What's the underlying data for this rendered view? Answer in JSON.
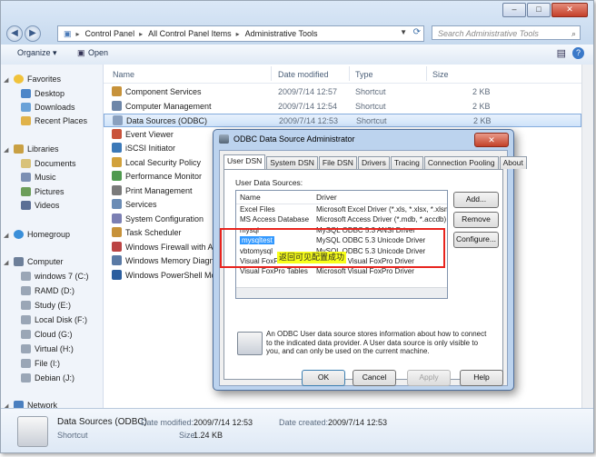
{
  "window": {
    "controls": {
      "minimize": "–",
      "maximize": "□",
      "close": "✕"
    },
    "address": {
      "crumbs": [
        "Control Panel",
        "All Control Panel Items",
        "Administrative Tools"
      ]
    },
    "search_placeholder": "Search Administrative Tools"
  },
  "toolbar": {
    "organize": "Organize ▾",
    "open": "Open",
    "help": "?"
  },
  "nav": {
    "favorites": "Favorites",
    "fav_items": [
      "Desktop",
      "Downloads",
      "Recent Places"
    ],
    "libraries": "Libraries",
    "lib_items": [
      "Documents",
      "Music",
      "Pictures",
      "Videos"
    ],
    "homegroup": "Homegroup",
    "computer": "Computer",
    "drives": [
      "windows 7 (C:)",
      "RAMD (D:)",
      "Study (E:)",
      "Local Disk (F:)",
      "Cloud (G:)",
      "Virtual (H:)",
      "File (I:)",
      "Debian (J:)"
    ],
    "network": "Network"
  },
  "columns": {
    "name": "Name",
    "date": "Date modified",
    "type": "Type",
    "size": "Size"
  },
  "files": [
    {
      "name": "Component Services",
      "date": "2009/7/14 12:57",
      "type": "Shortcut",
      "size": "2 KB"
    },
    {
      "name": "Computer Management",
      "date": "2009/7/14 12:54",
      "type": "Shortcut",
      "size": "2 KB"
    },
    {
      "name": "Data Sources (ODBC)",
      "date": "2009/7/14 12:53",
      "type": "Shortcut",
      "size": "2 KB"
    },
    {
      "name": "Event Viewer",
      "date": "",
      "type": "",
      "size": ""
    },
    {
      "name": "iSCSI Initiator",
      "date": "",
      "type": "",
      "size": ""
    },
    {
      "name": "Local Security Policy",
      "date": "",
      "type": "",
      "size": ""
    },
    {
      "name": "Performance Monitor",
      "date": "",
      "type": "",
      "size": ""
    },
    {
      "name": "Print Management",
      "date": "",
      "type": "",
      "size": ""
    },
    {
      "name": "Services",
      "date": "",
      "type": "",
      "size": ""
    },
    {
      "name": "System Configuration",
      "date": "",
      "type": "",
      "size": ""
    },
    {
      "name": "Task Scheduler",
      "date": "",
      "type": "",
      "size": ""
    },
    {
      "name": "Windows Firewall with Ad",
      "date": "",
      "type": "",
      "size": ""
    },
    {
      "name": "Windows Memory Diagno",
      "date": "",
      "type": "",
      "size": ""
    },
    {
      "name": "Windows PowerShell Mod",
      "date": "",
      "type": "",
      "size": ""
    }
  ],
  "details": {
    "name": "Data Sources (ODBC)",
    "type": "Shortcut",
    "modified_label": "Date modified:",
    "modified_value": "2009/7/14 12:53",
    "created_label": "Date created:",
    "created_value": "2009/7/14 12:53",
    "size_label": "Size:",
    "size_value": "1.24 KB"
  },
  "dialog": {
    "title": "ODBC Data Source Administrator",
    "close": "✕",
    "tabs": [
      "User DSN",
      "System DSN",
      "File DSN",
      "Drivers",
      "Tracing",
      "Connection Pooling",
      "About"
    ],
    "section_label": "User Data Sources:",
    "list_headers": {
      "name": "Name",
      "driver": "Driver"
    },
    "rows": [
      {
        "name": "Excel Files",
        "driver": "Microsoft Excel Driver (*.xls, *.xlsx, *.xlsm,"
      },
      {
        "name": "MS Access Database",
        "driver": "Microsoft Access Driver (*.mdb, *.accdb)"
      },
      {
        "name": "mysql",
        "driver": "MySQL ODBC 5.3 ANSI Driver"
      },
      {
        "name": "mysqltest",
        "driver": "MySQL ODBC 5.3 Unicode Driver"
      },
      {
        "name": "vbtomysql",
        "driver": "MySQL ODBC 5.3 Unicode Driver"
      },
      {
        "name": "Visual FoxPro Database",
        "driver": "Microsoft Visual FoxPro Driver"
      },
      {
        "name": "Visual FoxPro Tables",
        "driver": "Microsoft Visual FoxPro Driver"
      }
    ],
    "buttons": {
      "add": "Add...",
      "remove": "Remove",
      "configure": "Configure..."
    },
    "info_text": "An ODBC User data source stores information about how to connect to the indicated data provider. A User data source is only visible to you, and can only be used on the current machine.",
    "footer": {
      "ok": "OK",
      "cancel": "Cancel",
      "apply": "Apply",
      "help": "Help"
    }
  },
  "annotation": {
    "note": "返回可见配置成功"
  },
  "colors": {
    "highlight_box": "#e8241e",
    "note_bg": "#f8ff1a",
    "selection": "#3399ff"
  }
}
